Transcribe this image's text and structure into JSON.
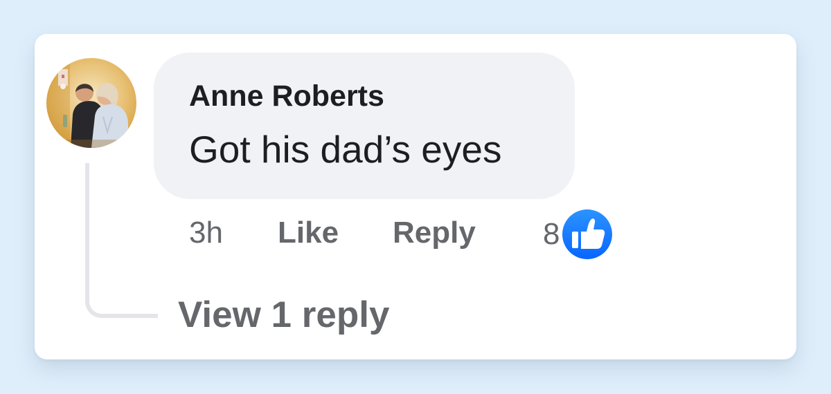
{
  "comment": {
    "author": "Anne Roberts",
    "text": "Got his dad’s eyes",
    "timestamp": "3h",
    "like_label": "Like",
    "reply_label": "Reply",
    "reaction_count": "8",
    "view_replies_label": "View 1 reply"
  },
  "icons": {
    "avatar": "profile-photo",
    "reaction": "thumbs-up-icon"
  },
  "colors": {
    "background": "#dfeefb",
    "card": "#ffffff",
    "bubble": "#f0f2f5",
    "primary_text": "#1c1e21",
    "secondary_text": "#65676b",
    "like_blue": "#1877f2"
  }
}
